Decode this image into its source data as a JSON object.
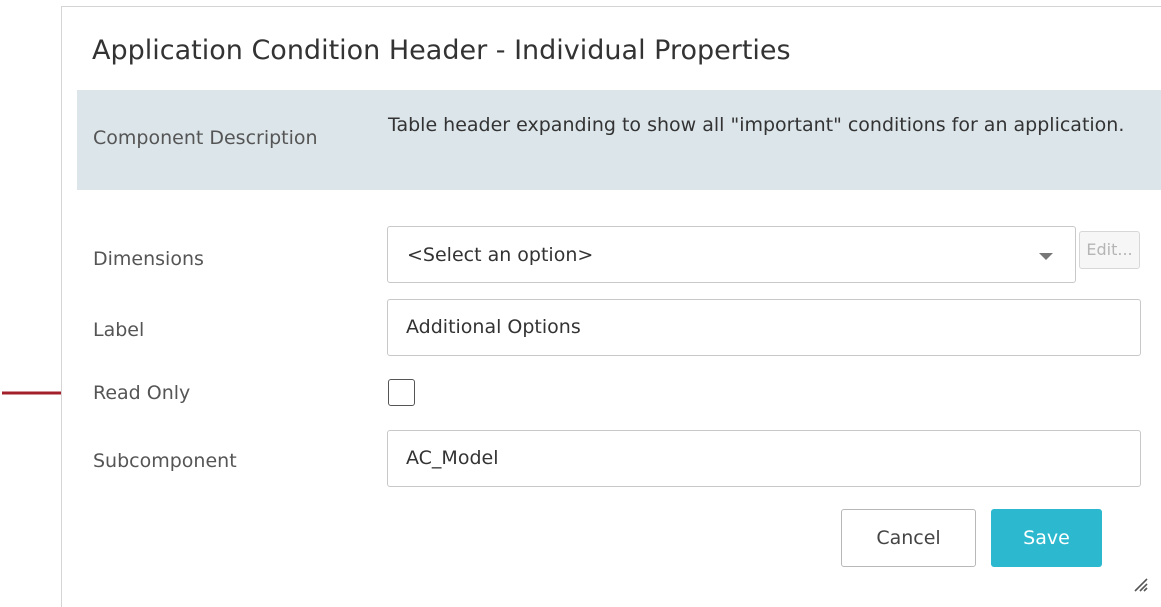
{
  "dialog": {
    "title": "Application Condition Header - Individual Properties"
  },
  "description": {
    "label": "Component Description",
    "text": "Table header expanding to show all \"important\" conditions for an application."
  },
  "fields": {
    "dimensions": {
      "label": "Dimensions",
      "value": "<Select an option>",
      "edit_label": "Edit..."
    },
    "label": {
      "label": "Label",
      "value": "Additional Options"
    },
    "read_only": {
      "label": "Read Only",
      "checked": false
    },
    "subcomponent": {
      "label": "Subcomponent",
      "value": "AC_Model"
    }
  },
  "buttons": {
    "cancel": "Cancel",
    "save": "Save"
  },
  "colors": {
    "accent": "#2cb9cf",
    "description_band": "#dce5ea",
    "annotation_arrow": "#a3202a"
  },
  "icons": {
    "dropdown": "chevron-down-icon",
    "resize": "resize-grip-icon",
    "annotation": "arrow-right-icon"
  }
}
